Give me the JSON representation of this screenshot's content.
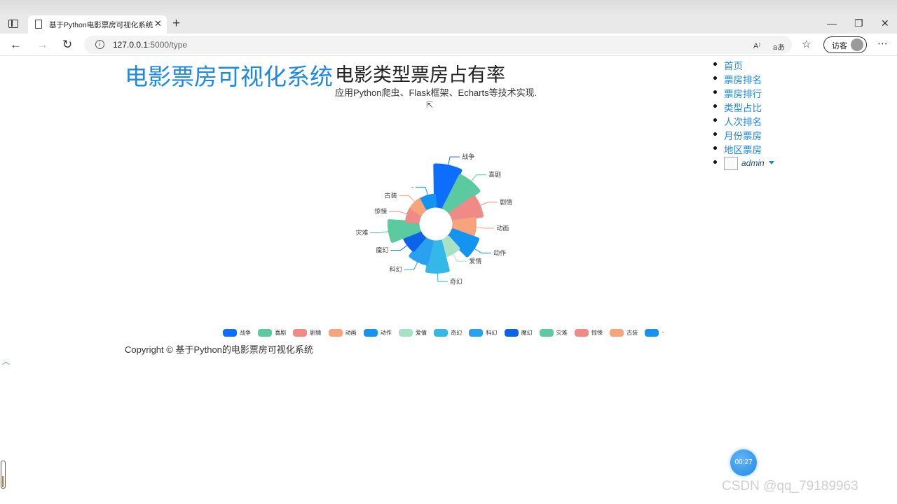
{
  "browser": {
    "tab_title": "基于Python电影票房可视化系统",
    "url_host": "127.0.0.1",
    "url_path": ":5000/type",
    "visitor_label": "访客"
  },
  "page": {
    "brand": "电影票房可视化系统",
    "heading": "电影类型票房占有率",
    "subheading": "应用Python爬虫、Flask框架、Echarts等技术实现.",
    "copyright": "Copyright © 基于Python的电影票房可视化系统"
  },
  "nav": {
    "items": [
      "首页",
      "票房排名",
      "票房排行",
      "类型占比",
      "人次排名",
      "月份票房",
      "地区票房"
    ],
    "user": "admin"
  },
  "overlay": {
    "timer": "00:27",
    "watermark": "CSDN @qq_79189963"
  },
  "chart_data": {
    "type": "pie",
    "variant": "rose-donut",
    "categories": [
      "战争",
      "喜剧",
      "剧情",
      "动画",
      "动作",
      "爱情",
      "奇幻",
      "科幻",
      "魔幻",
      "灾难",
      "惊悚",
      "古装",
      "-"
    ],
    "values": [
      100,
      85,
      62,
      38,
      55,
      20,
      66,
      44,
      24,
      62,
      8,
      8,
      6
    ],
    "colors": [
      "#0d6efd",
      "#5ccaa0",
      "#ef8a86",
      "#f7a37c",
      "#1493f0",
      "#a8e2c4",
      "#34b8e8",
      "#2aa0f0",
      "#0b63e8",
      "#5ccaa0",
      "#ef8a86",
      "#f7a37c",
      "#1493f0"
    ],
    "legend_position": "bottom"
  }
}
